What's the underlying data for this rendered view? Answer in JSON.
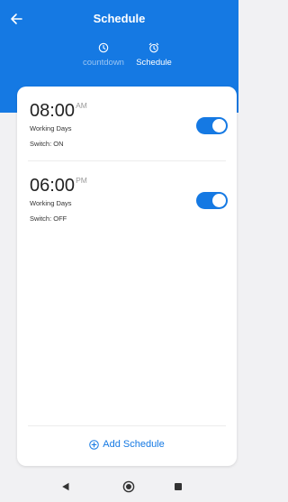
{
  "header": {
    "title": "Schedule",
    "tabs": [
      {
        "label": "countdown",
        "icon": "clock-icon",
        "active": false
      },
      {
        "label": "Schedule",
        "icon": "alarm-clock-icon",
        "active": true
      }
    ]
  },
  "schedules": [
    {
      "time": "08:00",
      "period": "AM",
      "days": "Working Days",
      "switch_status": "Switch: ON",
      "enabled": true
    },
    {
      "time": "06:00",
      "period": "PM",
      "days": "Working Days",
      "switch_status": "Switch: OFF",
      "enabled": true
    }
  ],
  "add_button": {
    "label": "Add Schedule",
    "icon": "plus-circle-icon"
  },
  "colors": {
    "primary": "#1579e3",
    "inactive_tab": "#9cc6f3",
    "background": "#f1f1f3",
    "card": "#ffffff"
  },
  "nav_bar": {
    "icons": [
      "back-triangle-icon",
      "home-circle-icon",
      "recents-square-icon"
    ]
  }
}
